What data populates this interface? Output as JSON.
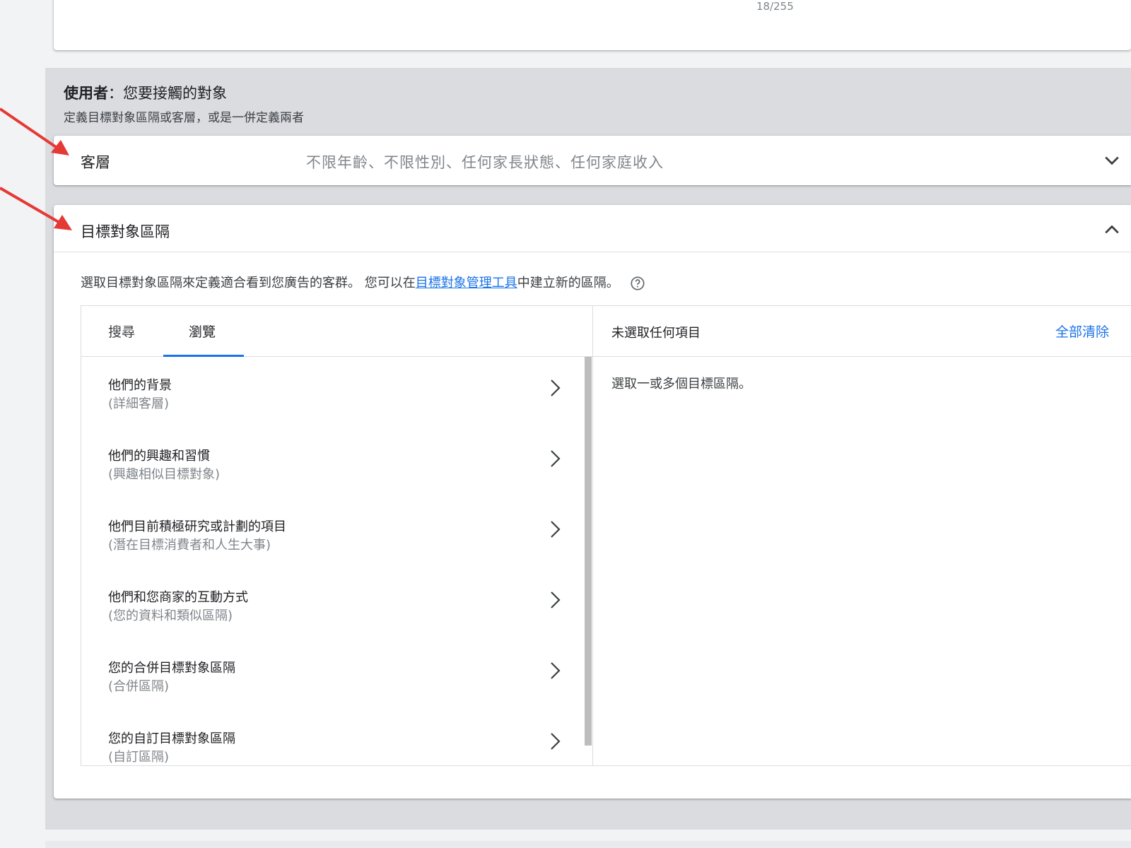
{
  "top_card": {
    "counter": "18/255"
  },
  "section": {
    "title_bold": "使用者",
    "title_rest": "：您要接觸的對象",
    "subtitle": "定義目標對象區隔或客層，或是一併定義兩者"
  },
  "demographics": {
    "title": "客層",
    "summary": "不限年齡、不限性別、任何家長狀態、任何家庭收入",
    "icon": "chevron-down-icon"
  },
  "audience": {
    "title": "目標對象區隔",
    "icon": "chevron-up-icon",
    "desc_before": "選取目標對象區隔來定義適合看到您廣告的客群。 您可以在",
    "desc_link": "目標對象管理工具",
    "desc_after": "中建立新的區隔。",
    "tabs": {
      "search": "搜尋",
      "browse": "瀏覽",
      "active": "browse"
    },
    "items": [
      {
        "name": "他們的背景",
        "sub": "(詳細客層)"
      },
      {
        "name": "他們的興趣和習慣",
        "sub": "(興趣相似目標對象)"
      },
      {
        "name": "他們目前積極研究或計劃的項目",
        "sub": "(潛在目標消費者和人生大事)"
      },
      {
        "name": "他們和您商家的互動方式",
        "sub": "(您的資料和類似區隔)"
      },
      {
        "name": "您的合併目標對象區隔",
        "sub": "(合併區隔)"
      },
      {
        "name": "您的自訂目標對象區隔",
        "sub": "(自訂區隔)"
      }
    ],
    "selection": {
      "none_label": "未選取任何項目",
      "clear_all": "全部清除",
      "hint": "選取一或多個目標區隔。"
    }
  },
  "colors": {
    "accent": "#1a73e8",
    "annotation": "#e53935"
  }
}
